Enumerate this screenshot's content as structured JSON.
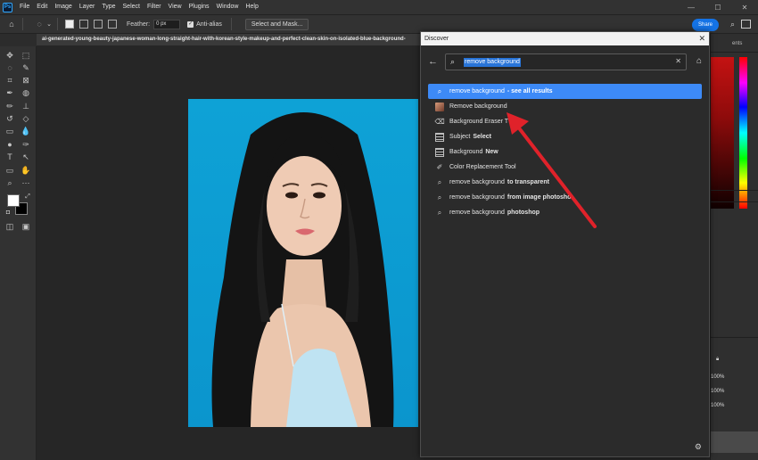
{
  "app": {
    "logo": "Ps",
    "menu": [
      "File",
      "Edit",
      "Image",
      "Layer",
      "Type",
      "Select",
      "Filter",
      "View",
      "Plugins",
      "Window",
      "Help"
    ],
    "window_controls": {
      "minimize": "—",
      "maximize": "☐",
      "close": "✕"
    }
  },
  "options_bar": {
    "feather_label": "Feather:",
    "feather_value": "0 px",
    "antialias_label": "Anti-alias",
    "select_mask_label": "Select and Mask...",
    "share_label": "Share"
  },
  "document": {
    "tab_title": "ai-generated-young-beauty-japanese-woman-long-straight-hair-with-korean-style-makeup-and-perfect-clean-skin-on-isolated-blue-background-"
  },
  "colors": {
    "foreground": "#ffffff",
    "background": "#000000",
    "accent": "#3d8af7",
    "photo_bg": "#0ea2d6"
  },
  "right_panel": {
    "tab_text": "ents",
    "opacity_1": "100%",
    "opacity_2": "100%",
    "opacity_3": "100%"
  },
  "discover": {
    "title": "Discover",
    "search_query": "remove background",
    "results": [
      {
        "icon": "search-icon",
        "text": "remove background",
        "suffix": "- see all results",
        "selected": true
      },
      {
        "icon": "thumbnail-icon",
        "text": "Remove background",
        "suffix": ""
      },
      {
        "icon": "eraser-icon",
        "text": "Background Eraser T",
        "suffix": ""
      },
      {
        "icon": "grid-icon",
        "text": "Subject",
        "suffix": "Select"
      },
      {
        "icon": "grid-icon",
        "text": "Background",
        "suffix": "New"
      },
      {
        "icon": "brush-icon",
        "text": "Color Replacement Tool",
        "suffix": ""
      },
      {
        "icon": "search-icon",
        "text": "remove background",
        "suffix": "to transparent"
      },
      {
        "icon": "search-icon",
        "text": "remove background",
        "suffix": "from image photosho"
      },
      {
        "icon": "search-icon",
        "text": "remove background",
        "suffix": "photoshop"
      }
    ]
  }
}
